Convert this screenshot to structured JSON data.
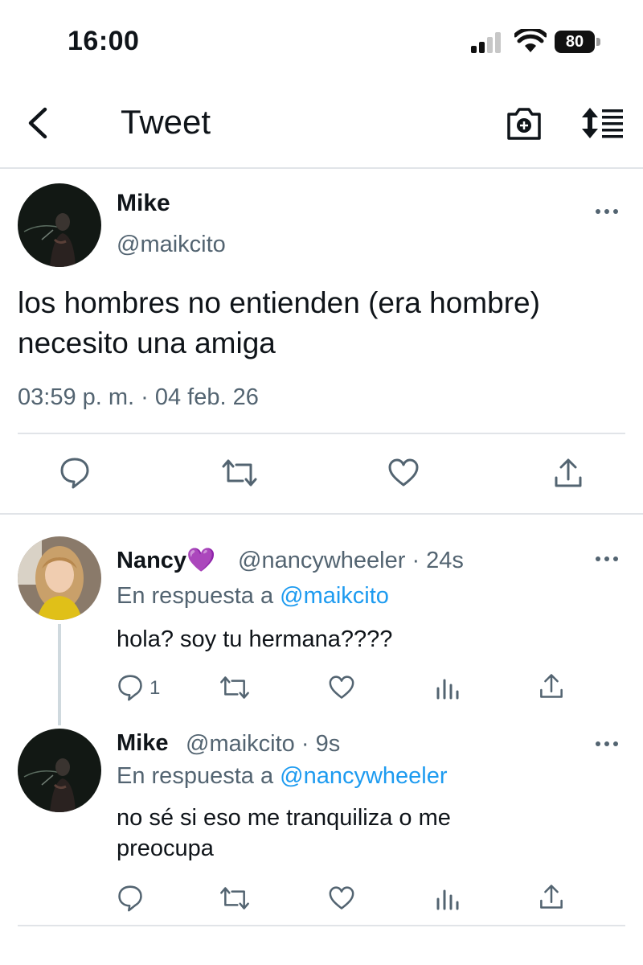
{
  "status_bar": {
    "time": "16:00",
    "battery": "80",
    "icons": [
      "signal-icon",
      "wifi-icon",
      "battery-icon"
    ]
  },
  "header": {
    "title": "Tweet",
    "icons": [
      "back-arrow-icon",
      "camera-plus-icon",
      "sort-replies-icon"
    ]
  },
  "main_tweet": {
    "name": "Mike",
    "handle": "@maikcito",
    "text_lines": [
      "los hombres no entienden (era hombre)",
      "necesito una amiga"
    ],
    "timestamp": "03:59 p. m. · 04 feb. 26",
    "actions": [
      "reply-icon",
      "retweet-icon",
      "like-icon",
      "share-icon"
    ]
  },
  "replies": [
    {
      "name": "Nancy",
      "emoji": "💜",
      "meta": "@nancywheeler · 24s",
      "reply_prefix": "En respuesta a ",
      "reply_to": "@maikcito",
      "text_lines": [
        "hola? soy tu hermana????"
      ],
      "reply_count": "1"
    },
    {
      "name": "Mike",
      "meta": "@maikcito · 9s",
      "reply_prefix": "En respuesta a ",
      "reply_to": "@nancywheeler",
      "text_lines": [
        "no sé si eso me tranquiliza o me",
        "preocupa"
      ]
    }
  ],
  "colors": {
    "text": "#0f1419",
    "secondary": "#536471",
    "link": "#1d9bf0",
    "divider": "#e1e4e8",
    "thread_line": "#cfd9de"
  }
}
